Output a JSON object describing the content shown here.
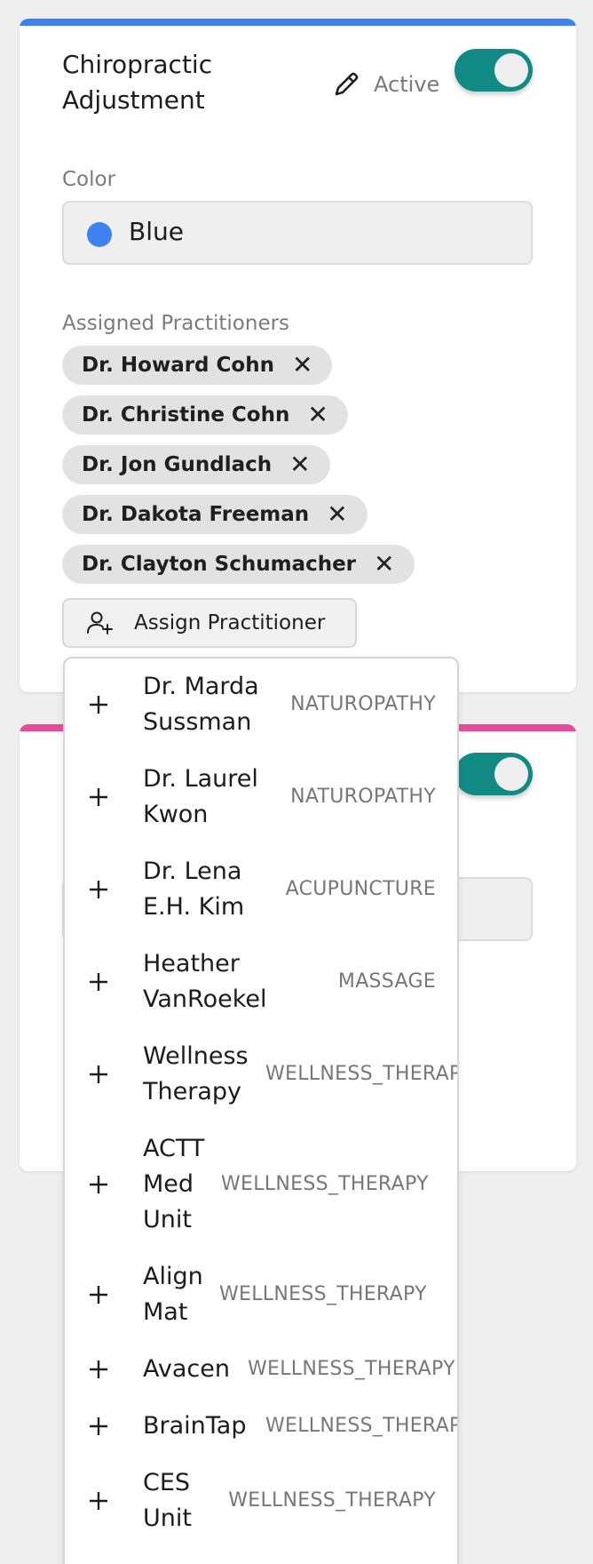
{
  "card1": {
    "title": "Chiropractic Adjustment",
    "status_label": "Active",
    "color_label": "Color",
    "color_value": "Blue",
    "color_hex": "#3d82ee",
    "practitioners_label": "Assigned Practitioners",
    "practitioners": [
      "Dr. Howard Cohn",
      "Dr. Christine Cohn",
      "Dr. Jon Gundlach",
      "Dr. Dakota Freeman",
      "Dr. Clayton Schumacher"
    ],
    "assign_button_label": "Assign Practitioner"
  },
  "card2": {
    "accent_hex": "#e84a9a"
  },
  "dropdown": {
    "options": [
      {
        "name": "Dr. Marda\nSussman",
        "category": "NATUROPATHY"
      },
      {
        "name": "Dr. Laurel\nKwon",
        "category": "NATUROPATHY"
      },
      {
        "name": "Dr. Lena\nE.H. Kim",
        "category": "ACUPUNCTURE"
      },
      {
        "name": "Heather\nVanRoekel",
        "category": "MASSAGE"
      },
      {
        "name": "Wellness\nTherapy",
        "category": "WELLNESS_THERAPY"
      },
      {
        "name": "ACTT\nMed\nUnit",
        "category": "WELLNESS_THERAPY"
      },
      {
        "name": "Align\nMat",
        "category": "WELLNESS_THERAPY"
      },
      {
        "name": "Avacen",
        "category": "WELLNESS_THERAPY"
      },
      {
        "name": "BrainTap",
        "category": "WELLNESS_THERAPY"
      },
      {
        "name": "CES\nUnit",
        "category": "WELLNESS_THERAPY"
      }
    ]
  },
  "icons": {
    "edit": "pencil-icon",
    "remove": "close-icon",
    "assign": "user-plus-icon",
    "add": "plus-icon"
  }
}
